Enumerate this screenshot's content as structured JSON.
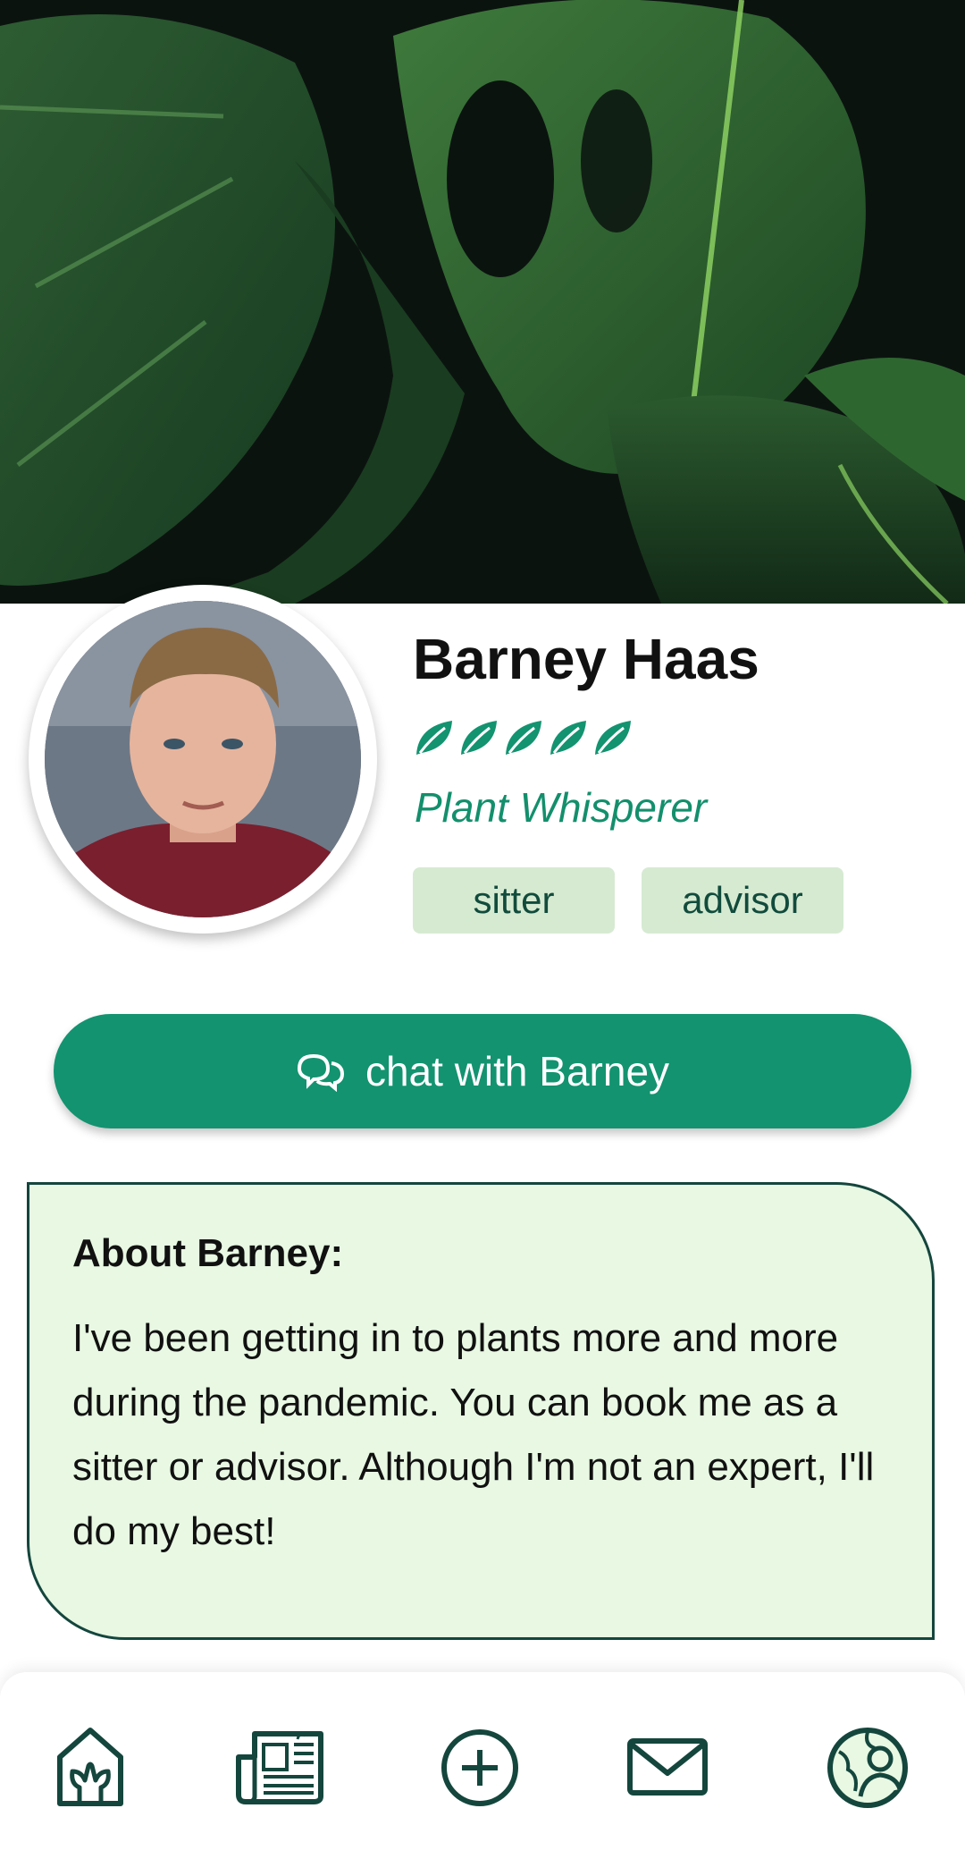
{
  "profile": {
    "name": "Barney Haas",
    "rating": 5,
    "subtitle": "Plant Whisperer",
    "tags": [
      "sitter",
      "advisor"
    ]
  },
  "actions": {
    "chat_label": "chat with Barney",
    "chat_icon": "chat-bubbles-icon"
  },
  "about": {
    "title": "About Barney:",
    "text": "I've been getting in to plants more and more during the pandemic. You can book me as a sitter or advisor. Although I'm not an expert, I'll do my best!"
  },
  "nav": {
    "items": [
      {
        "name": "home",
        "icon": "plant-house-icon"
      },
      {
        "name": "feed",
        "icon": "newspaper-icon"
      },
      {
        "name": "add",
        "icon": "plus-circle-icon"
      },
      {
        "name": "messages",
        "icon": "envelope-icon"
      },
      {
        "name": "profile",
        "icon": "profile-globe-icon",
        "active": true
      }
    ]
  },
  "colors": {
    "accent": "#139370",
    "dark_green": "#14463d",
    "tag_bg": "#d6ead2",
    "about_bg": "#e8f8e3",
    "subtitle": "#138f6c"
  }
}
